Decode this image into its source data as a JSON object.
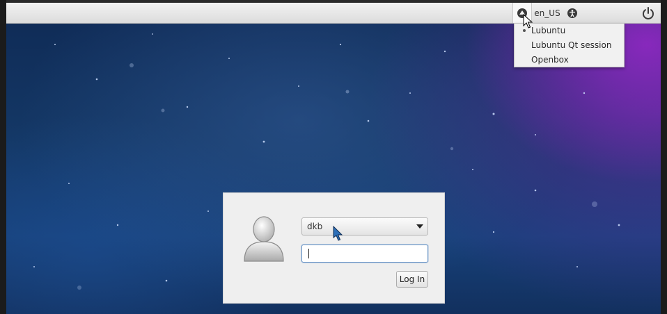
{
  "topbar": {
    "session_icon": "session-icon",
    "language": "en_US",
    "accessibility_icon": "accessibility-icon",
    "power_icon": "power-icon"
  },
  "session_menu": {
    "items": [
      {
        "label": "Lubuntu",
        "selected": true
      },
      {
        "label": "Lubuntu Qt session",
        "selected": false
      },
      {
        "label": "Openbox",
        "selected": false
      }
    ]
  },
  "login": {
    "avatar_icon": "user-avatar-icon",
    "username": "dkb",
    "password": "",
    "login_button": "Log In"
  },
  "colors": {
    "topbar_bg": "#e6e6e6",
    "panel_bg": "#efefef",
    "focus_border": "#6d97c7"
  }
}
